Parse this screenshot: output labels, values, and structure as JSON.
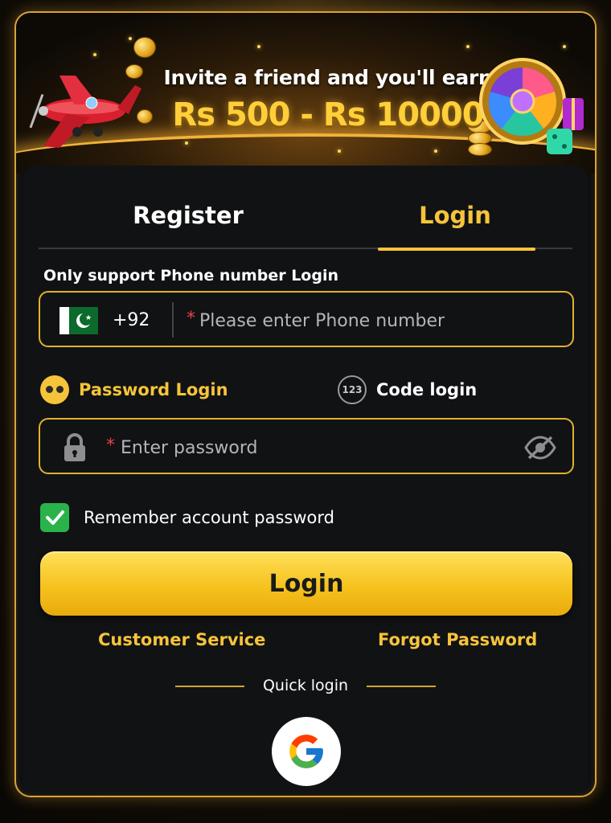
{
  "banner": {
    "line1": "Invite a friend and you'll earn",
    "line2": "Rs 500 - Rs 10000"
  },
  "tabs": [
    {
      "label": "Register",
      "active": false
    },
    {
      "label": "Login",
      "active": true
    }
  ],
  "support_text": "Only support Phone number Login",
  "phone": {
    "country_flag": "pakistan-flag-icon",
    "country_code": "+92",
    "required_mark": "*",
    "placeholder": "Please enter Phone number",
    "value": ""
  },
  "login_modes": {
    "password": {
      "label": "Password Login",
      "icon": "password-mode-icon",
      "active": true
    },
    "code": {
      "label": "Code login",
      "icon_text": "123",
      "active": false
    }
  },
  "password": {
    "required_mark": "*",
    "placeholder": "Enter password",
    "value": "",
    "lock_icon": "lock-icon",
    "visibility_icon": "eye-slash-icon"
  },
  "remember": {
    "label": "Remember account password",
    "checked": true
  },
  "login_button": "Login",
  "links": {
    "customer_service": "Customer Service",
    "forgot_password": "Forgot Password"
  },
  "quick_login": {
    "label": "Quick login",
    "providers": [
      "google"
    ]
  },
  "colors": {
    "accent_gold": "#f6c43a",
    "background": "#111214",
    "check_green": "#29b34a",
    "required_red": "#e8424a"
  }
}
